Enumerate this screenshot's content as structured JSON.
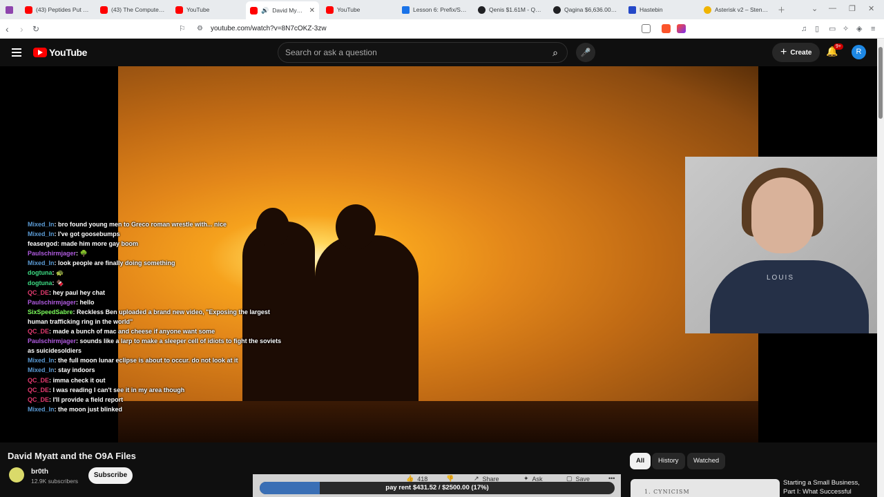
{
  "tabs": [
    {
      "title": "(43) Peptides Put Sci...",
      "icon": "youtube-icon"
    },
    {
      "title": "(43) The Computer C...",
      "icon": "youtube-icon"
    },
    {
      "title": "YouTube",
      "icon": "youtube-icon"
    },
    {
      "title": "David Myatt a...",
      "icon": "youtube-icon",
      "active": true
    },
    {
      "title": "YouTube",
      "icon": "youtube-icon"
    },
    {
      "title": "Lesson 6: Prefix/Suff...",
      "icon": "doc-icon"
    },
    {
      "title": "Qenis $1.61M - Qen...",
      "icon": "token-icon"
    },
    {
      "title": "Qagina $6,636.00 - Q...",
      "icon": "token-icon"
    },
    {
      "title": "Hastebin",
      "icon": "hastebin-icon"
    },
    {
      "title": "Asterisk v2 – Stenok...",
      "icon": "asterisk-icon"
    }
  ],
  "address": {
    "url": "youtube.com/watch?v=8N7cOKZ-3zw"
  },
  "header": {
    "logo_text": "YouTube",
    "search_placeholder": "Search or ask a question",
    "create_label": "Create",
    "notification_count": "9+",
    "avatar_initial": "R"
  },
  "chat": [
    {
      "user": "Mixed_In",
      "color": "#5b9bd5",
      "text": "bro found young men to Greco roman wrestle with... nice"
    },
    {
      "user": "Mixed_In",
      "color": "#5b9bd5",
      "text": "I've got goosebumps"
    },
    {
      "user": "feasergod",
      "color": "#ffffff",
      "text": "made him more gay boom"
    },
    {
      "user": "Paulschirmjager",
      "color": "#b05be0",
      "text": "🌳"
    },
    {
      "user": "Mixed_In",
      "color": "#5b9bd5",
      "text": "look people are finally doing something"
    },
    {
      "user": "dogtuna",
      "color": "#3ddc84",
      "text": "🐢"
    },
    {
      "user": "dogtuna",
      "color": "#3ddc84",
      "text": "🍫"
    },
    {
      "user": "QC_DE",
      "color": "#e23a6f",
      "text": "hey paul hey chat"
    },
    {
      "user": "Paulschirmjager",
      "color": "#b05be0",
      "text": "hello"
    },
    {
      "user": "SixSpeedSabre",
      "color": "#7cfc5b",
      "text": "Reckless Ben uploaded a brand new video, \"Exposing the largest human trafficking ring in the world\""
    },
    {
      "user": "QC_DE",
      "color": "#e23a6f",
      "text": "made a bunch of mac and cheese if anyone want some"
    },
    {
      "user": "Paulschirmjager",
      "color": "#b05be0",
      "text": "sounds like a larp to make a sleeper cell of idiots to fight the soviets as suicidesoldiers"
    },
    {
      "user": "Mixed_In",
      "color": "#5b9bd5",
      "text": "the full moon lunar eclipse is about to occur. do not look at it"
    },
    {
      "user": "Mixed_In",
      "color": "#5b9bd5",
      "text": "stay indoors"
    },
    {
      "user": "QC_DE",
      "color": "#e23a6f",
      "text": "imma check it out"
    },
    {
      "user": "QC_DE",
      "color": "#e23a6f",
      "text": "I was reading I can't see it in my area though"
    },
    {
      "user": "QC_DE",
      "color": "#e23a6f",
      "text": "I'll provide a field report"
    },
    {
      "user": "Mixed_In",
      "color": "#5b9bd5",
      "text": "the moon just blinked"
    }
  ],
  "webcam": {
    "shirt_text": "LOUIS"
  },
  "video": {
    "title": "David Myatt and the O9A Files",
    "channel": "br0th",
    "subscribers": "12.9K subscribers",
    "subscribe_label": "Subscribe"
  },
  "actions": {
    "like_count": "418",
    "share_label": "Share",
    "ask_label": "Ask",
    "save_label": "Save",
    "more_label": "•••"
  },
  "goal": {
    "text": "pay rent $431.52 / $2500.00 (17%)",
    "fraction": 0.17
  },
  "chips": [
    "All",
    "History",
    "Watched"
  ],
  "recommendation": {
    "title": "Starting a Small Business, Part I: What Successful",
    "thumb_text": "1. CYNICISM"
  },
  "colors": {
    "brand_red": "#ff0000",
    "background": "#0f0f0f",
    "progress": "#3a6fb5"
  }
}
